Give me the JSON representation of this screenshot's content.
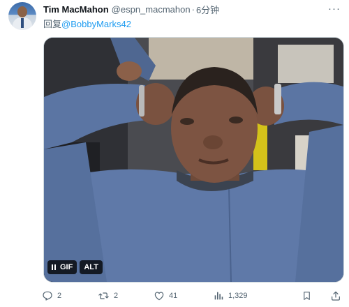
{
  "tweet": {
    "author_name": "Tim MacMahon",
    "handle": "@espn_macmahon",
    "separator": "·",
    "time": "6分钟",
    "reply_prefix": "回复",
    "reply_mention": "@BobbyMarks42"
  },
  "media": {
    "pause_icon": "pause-icon",
    "gif_label": "GIF",
    "alt_label": "ALT"
  },
  "actions": {
    "reply_count": "2",
    "retweet_count": "2",
    "like_count": "41",
    "views_count": "1,329"
  },
  "colors": {
    "text": "#0f1419",
    "secondary": "#536471",
    "link": "#1d9bf0"
  }
}
